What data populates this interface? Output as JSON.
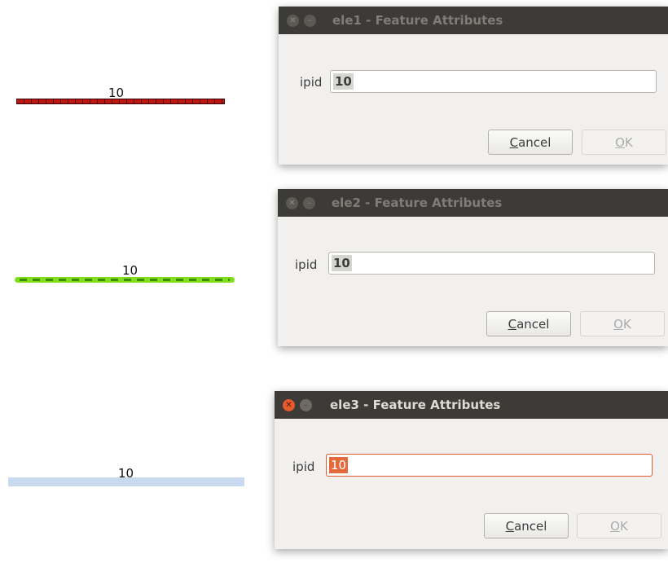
{
  "canvas": {
    "features": [
      {
        "label": "10",
        "style": "red-dotted-line",
        "color": "#c0140f"
      },
      {
        "label": "10",
        "style": "green-dashed-line",
        "color": "#7fe01a"
      },
      {
        "label": "10",
        "style": "light-blue-line",
        "color": "#c9d9ef"
      }
    ]
  },
  "dialogs": [
    {
      "title": "ele1 - Feature Attributes",
      "active": false,
      "field_label": "ipid",
      "field_value": "10",
      "cancel_mnemonic": "C",
      "cancel_rest": "ancel",
      "ok_mnemonic": "O",
      "ok_rest": "K"
    },
    {
      "title": "ele2 - Feature Attributes",
      "active": false,
      "field_label": "ipid",
      "field_value": "10",
      "cancel_mnemonic": "C",
      "cancel_rest": "ancel",
      "ok_mnemonic": "O",
      "ok_rest": "K"
    },
    {
      "title": "ele3 - Feature Attributes",
      "active": true,
      "field_label": "ipid",
      "field_value": "10",
      "cancel_mnemonic": "C",
      "cancel_rest": "ancel",
      "ok_mnemonic": "O",
      "ok_rest": "K"
    }
  ],
  "icons": {
    "close": "close-icon",
    "minimize": "minimize-icon"
  },
  "colors": {
    "titlebar": "#3c3b37",
    "dialog_bg": "#f1f0ee",
    "active_close": "#e65a2e",
    "focus_border": "#e0582b",
    "selection": "#e46a3c"
  }
}
